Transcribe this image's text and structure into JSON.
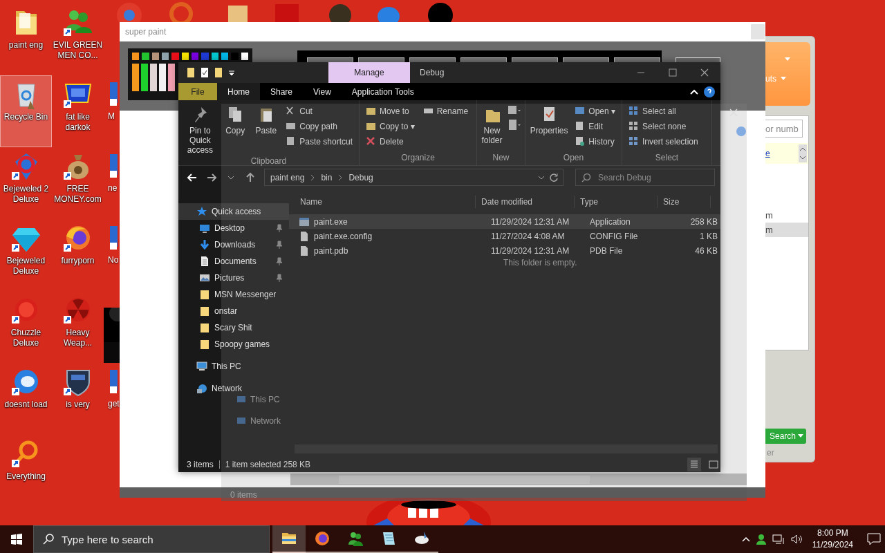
{
  "desktop": {
    "columns": [
      [
        {
          "label": "paint eng",
          "kind": "folder",
          "selected": false
        },
        {
          "label": "Recycle Bin",
          "kind": "recycle",
          "selected": true
        },
        {
          "label": "Bejeweled 2 Deluxe",
          "kind": "ring",
          "selected": false
        },
        {
          "label": "Bejeweled Deluxe",
          "kind": "gem",
          "selected": false
        },
        {
          "label": "Chuzzle Deluxe",
          "kind": "ball",
          "selected": false
        },
        {
          "label": "doesnt load",
          "kind": "bird",
          "selected": false
        },
        {
          "label": "Everything",
          "kind": "magnifier",
          "selected": false
        }
      ],
      [
        {
          "label": "EVIL GREEN MEN CO...",
          "kind": "people",
          "selected": false
        },
        {
          "label": "fat like darkok",
          "kind": "logo",
          "selected": false
        },
        {
          "label": "FREE MONEY.com",
          "kind": "money",
          "selected": false
        },
        {
          "label": "furryporn",
          "kind": "globe",
          "selected": false
        },
        {
          "label": "Heavy Weap...",
          "kind": "radiation",
          "selected": false
        },
        {
          "label": "is very",
          "kind": "shield",
          "selected": false
        }
      ]
    ],
    "partial_labels": [
      "M",
      "ne",
      "No",
      "get"
    ]
  },
  "paint_window": {
    "title": "super paint",
    "palette": [
      {
        "color": "#f7941d"
      },
      {
        "color": "#22c32e"
      },
      {
        "color": "#b5937a"
      },
      {
        "color": "#8fa3ad"
      },
      {
        "color": "#e8101a"
      },
      {
        "color": "#f5e300"
      },
      {
        "color": "#7a00e0"
      },
      {
        "color": "#1f3bd6"
      },
      {
        "color": "#00c8d0"
      },
      {
        "color": "#00b6e8"
      },
      {
        "color": "#000000"
      },
      {
        "color": "#ffffff"
      }
    ],
    "palette_bars": [
      {
        "color": "#f39a1e"
      },
      {
        "color": "#1ed12c"
      },
      {
        "color": "#e0d6d6"
      },
      {
        "color": "#f2f2f2"
      },
      {
        "color": "#f0a0b0"
      }
    ]
  },
  "explorer": {
    "context_tab": "Manage",
    "title": "Debug",
    "tabs": [
      {
        "label": "File",
        "kind": "file",
        "selected": false
      },
      {
        "label": "Home",
        "kind": "tab",
        "selected": true
      },
      {
        "label": "Share",
        "kind": "tab",
        "selected": false
      },
      {
        "label": "View",
        "kind": "tab",
        "selected": false
      },
      {
        "label": "Application Tools",
        "kind": "tab",
        "selected": false
      }
    ],
    "ribbon": [
      {
        "label": "Clipboard",
        "items": [
          {
            "label": "Pin to Quick access",
            "kind": "large"
          },
          {
            "label": "Copy",
            "kind": "large"
          },
          {
            "label": "Paste",
            "kind": "large"
          },
          {
            "label": "Cut",
            "kind": "small"
          },
          {
            "label": "Copy path",
            "kind": "small"
          },
          {
            "label": "Paste shortcut",
            "kind": "small"
          }
        ]
      },
      {
        "label": "Organize",
        "items": [
          {
            "label": "Move to",
            "kind": "small"
          },
          {
            "label": "Copy to ▾",
            "kind": "small"
          },
          {
            "label": "Delete",
            "kind": "small"
          },
          {
            "label": "Rename",
            "kind": "small"
          }
        ]
      },
      {
        "label": "New",
        "items": [
          {
            "label": "New folder",
            "kind": "large"
          }
        ]
      },
      {
        "label": "Open",
        "items": [
          {
            "label": "Properties",
            "kind": "large"
          },
          {
            "label": "Open ▾",
            "kind": "small"
          },
          {
            "label": "Edit",
            "kind": "small"
          },
          {
            "label": "History",
            "kind": "small"
          }
        ]
      },
      {
        "label": "Select",
        "items": [
          {
            "label": "Select all",
            "kind": "small"
          },
          {
            "label": "Select none",
            "kind": "small"
          },
          {
            "label": "Invert selection",
            "kind": "small"
          }
        ]
      }
    ],
    "path": [
      "paint eng",
      "bin",
      "Debug"
    ],
    "search_placeholder": "Search Debug",
    "nav": [
      {
        "label": "Quick access",
        "kind": "star",
        "selected": true,
        "children": [
          {
            "label": "Desktop",
            "kind": "desktop",
            "pinned": true,
            "selected": false
          },
          {
            "label": "Downloads",
            "kind": "download",
            "pinned": true,
            "selected": false
          },
          {
            "label": "Documents",
            "kind": "document",
            "pinned": true,
            "selected": false
          },
          {
            "label": "Pictures",
            "kind": "picture",
            "pinned": true,
            "selected": false
          },
          {
            "label": "MSN Messenger",
            "kind": "folder",
            "pinned": false,
            "selected": false
          },
          {
            "label": "onstar",
            "kind": "folder",
            "pinned": false,
            "selected": false
          },
          {
            "label": "Scary Shit",
            "kind": "folder",
            "pinned": false,
            "selected": false
          },
          {
            "label": "Spoopy games",
            "kind": "folder",
            "pinned": false,
            "selected": false
          }
        ]
      },
      {
        "label": "This PC",
        "kind": "pc",
        "selected": false
      },
      {
        "label": "Network",
        "kind": "network",
        "selected": false
      }
    ],
    "columns": [
      "Name",
      "Date modified",
      "Type",
      "Size"
    ],
    "rows": [
      {
        "name": "paint.exe",
        "kind": "exe",
        "date": "11/29/2024 12:31 AM",
        "type": "Application",
        "size": "258 KB",
        "selected": true
      },
      {
        "name": "paint.exe.config",
        "kind": "file",
        "date": "11/27/2024 4:08 AM",
        "type": "CONFIG File",
        "size": "1 KB",
        "selected": false
      },
      {
        "name": "paint.pdb",
        "kind": "file",
        "date": "11/29/2024 12:31 AM",
        "type": "PDB File",
        "size": "46 KB",
        "selected": false
      }
    ],
    "status_count": "3 items",
    "status_selection": "1 item selected  258 KB"
  },
  "ghost_window": {
    "empty_text": "This folder is empty.",
    "nav": [
      "This PC",
      "Network"
    ],
    "status": "0 items"
  },
  "side_window": {
    "menu_label": "uts",
    "field_placeholder": "or numb",
    "link": "e",
    "list": [
      {
        "label": "m",
        "selected": false
      },
      {
        "label": "m",
        "selected": true
      }
    ],
    "button": "Search",
    "footer": "er"
  },
  "taskbar": {
    "search_placeholder": "Type here to search",
    "apps": [
      {
        "kind": "folder",
        "selected": true
      },
      {
        "kind": "globe",
        "selected": false
      },
      {
        "kind": "people",
        "selected": false
      },
      {
        "kind": "notepad",
        "selected": false
      },
      {
        "kind": "paint",
        "selected": false
      }
    ],
    "time": "8:00 PM",
    "date": "11/29/2024"
  }
}
